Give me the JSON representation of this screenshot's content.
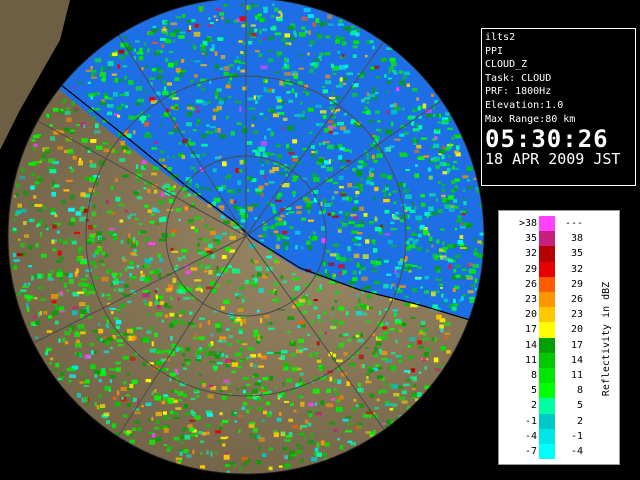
{
  "info": {
    "station": "ilts2",
    "scan": "PPI",
    "product": "CLOUD_Z",
    "task": "Task: CLOUD",
    "prf": "PRF: 1800Hz",
    "elevation": "Elevation:1.0",
    "max_range": "Max Range:80 km",
    "time": "05:30:26",
    "date": "18 APR 2009 JST"
  },
  "legend": {
    "unit": "Reflectivity in dBZ",
    "rows": [
      {
        "lo": ">38",
        "hi": "---",
        "color": "#ff40ff"
      },
      {
        "lo": "35",
        "hi": "38",
        "color": "#c81e7c"
      },
      {
        "lo": "32",
        "hi": "35",
        "color": "#b40000"
      },
      {
        "lo": "29",
        "hi": "32",
        "color": "#e60000"
      },
      {
        "lo": "26",
        "hi": "29",
        "color": "#ff5a00"
      },
      {
        "lo": "23",
        "hi": "26",
        "color": "#ff9600"
      },
      {
        "lo": "20",
        "hi": "23",
        "color": "#ffc800"
      },
      {
        "lo": "17",
        "hi": "20",
        "color": "#ffff00"
      },
      {
        "lo": "14",
        "hi": "17",
        "color": "#00a000"
      },
      {
        "lo": "11",
        "hi": "14",
        "color": "#00c800"
      },
      {
        "lo": "8",
        "hi": "11",
        "color": "#00e600"
      },
      {
        "lo": "5",
        "hi": "8",
        "color": "#00ff00"
      },
      {
        "lo": "2",
        "hi": "5",
        "color": "#00ffa0"
      },
      {
        "lo": "-1",
        "hi": "2",
        "color": "#00c8c8"
      },
      {
        "lo": "-4",
        "hi": "-1",
        "color": "#00e6e6"
      },
      {
        "lo": "-7",
        "hi": "-4",
        "color": "#00ffff"
      }
    ]
  },
  "colors": {
    "background": "#000000",
    "sea": "#1e6ee6",
    "land": "#8c7a5a",
    "range_ring": "#4a4a4a"
  }
}
